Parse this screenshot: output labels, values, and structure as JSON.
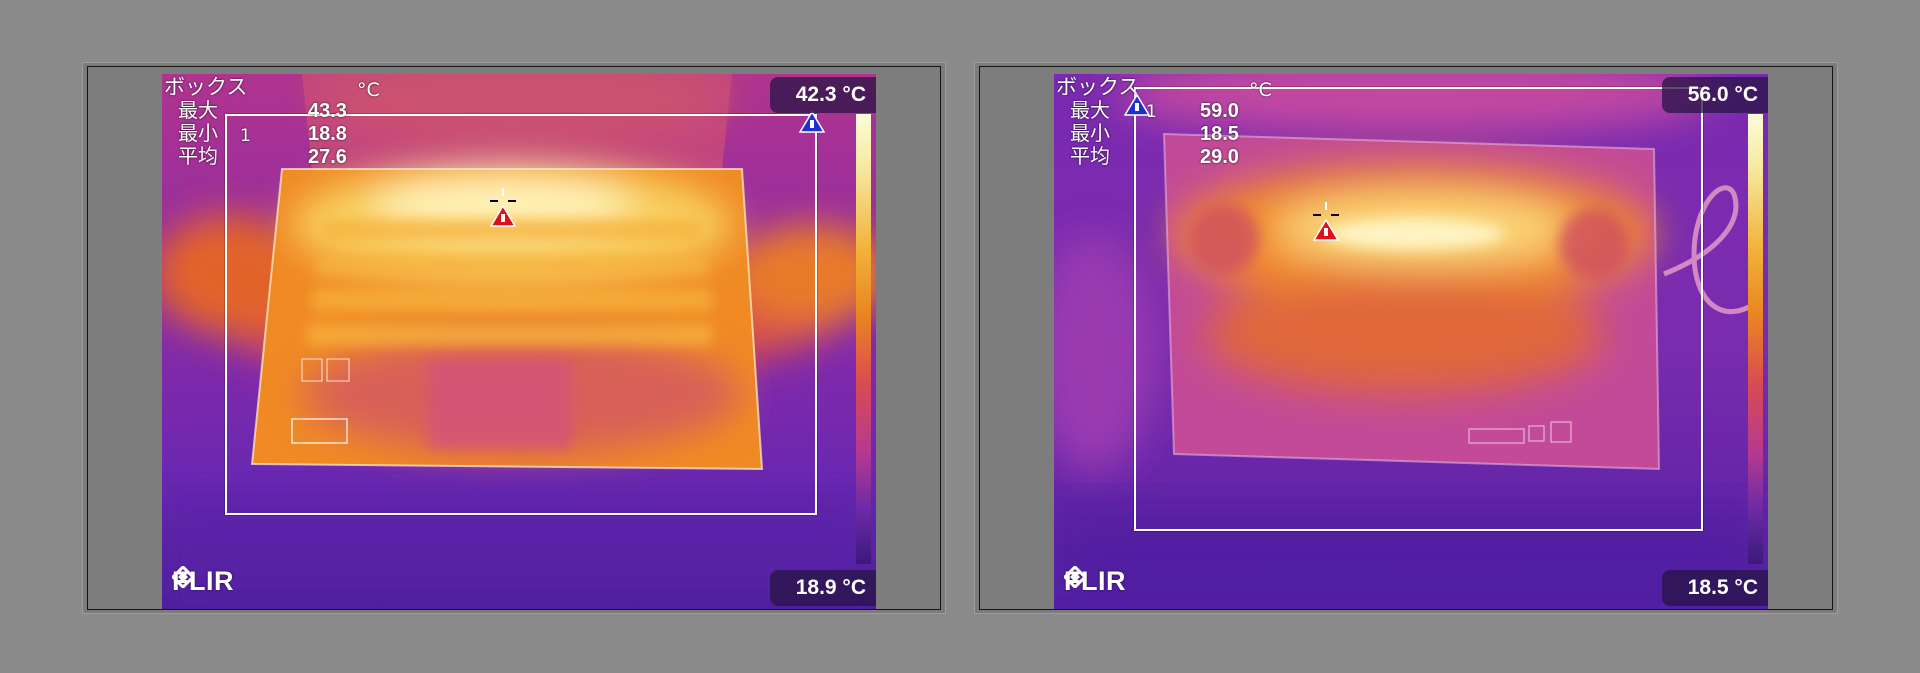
{
  "colors": {
    "background": "#8a8a8a",
    "thermal_hot": "#fff6c8",
    "thermal_warm": "#f28a22",
    "thermal_mid": "#c73e9a",
    "thermal_cold": "#3a1a7a",
    "hot_marker": "#e0101a",
    "cold_marker": "#2030d0"
  },
  "panels": [
    {
      "box_label": "ボックス",
      "unit": "°C",
      "roi_number": "1",
      "stats": [
        {
          "label": "最大",
          "value": "43.3"
        },
        {
          "label": "最小",
          "value": "18.8"
        },
        {
          "label": "平均",
          "value": "27.6"
        }
      ],
      "scale_max": "42.3 °C",
      "scale_min": "18.9 °C",
      "logo": "FLIR",
      "markers": [
        "hot-spot-triangle",
        "cold-spot-triangle",
        "crosshair"
      ]
    },
    {
      "box_label": "ボックス",
      "unit": "°C",
      "roi_number": "1",
      "stats": [
        {
          "label": "最大",
          "value": "59.0"
        },
        {
          "label": "最小",
          "value": "18.5"
        },
        {
          "label": "平均",
          "value": "29.0"
        }
      ],
      "scale_max": "56.0 °C",
      "scale_min": "18.5 °C",
      "logo": "FLIR",
      "markers": [
        "hot-spot-triangle",
        "cold-spot-triangle",
        "crosshair"
      ]
    }
  ]
}
